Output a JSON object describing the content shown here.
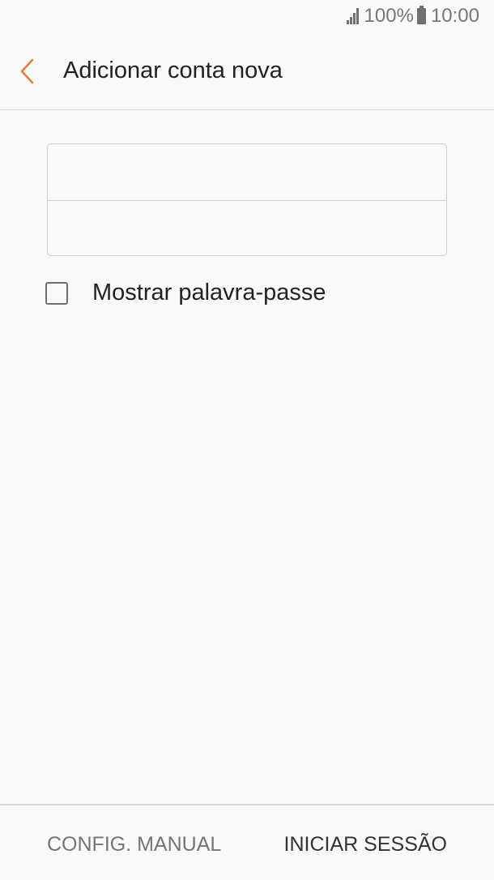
{
  "status_bar": {
    "battery_text": "100%",
    "time": "10:00",
    "signal_icon": "signal-bars-icon",
    "battery_icon": "battery-icon"
  },
  "app_bar": {
    "back_icon": "chevron-left-icon",
    "title": "Adicionar conta nova",
    "accent_color": "#f0733a"
  },
  "form": {
    "email_field": {
      "value": "",
      "placeholder": ""
    },
    "password_field": {
      "value": "",
      "placeholder": ""
    },
    "show_password": {
      "label": "Mostrar palavra-passe",
      "checked": false
    }
  },
  "bottom_bar": {
    "manual_setup_label": "CONFIG. MANUAL",
    "sign_in_label": "INICIAR SESSÃO"
  }
}
